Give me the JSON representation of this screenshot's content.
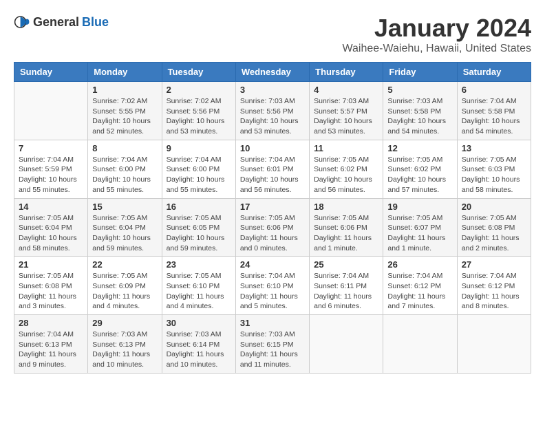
{
  "header": {
    "logo_general": "General",
    "logo_blue": "Blue",
    "month_title": "January 2024",
    "location": "Waihee-Waiehu, Hawaii, United States"
  },
  "calendar": {
    "days_of_week": [
      "Sunday",
      "Monday",
      "Tuesday",
      "Wednesday",
      "Thursday",
      "Friday",
      "Saturday"
    ],
    "weeks": [
      [
        {
          "day": "",
          "info": ""
        },
        {
          "day": "1",
          "info": "Sunrise: 7:02 AM\nSunset: 5:55 PM\nDaylight: 10 hours\nand 52 minutes."
        },
        {
          "day": "2",
          "info": "Sunrise: 7:02 AM\nSunset: 5:56 PM\nDaylight: 10 hours\nand 53 minutes."
        },
        {
          "day": "3",
          "info": "Sunrise: 7:03 AM\nSunset: 5:56 PM\nDaylight: 10 hours\nand 53 minutes."
        },
        {
          "day": "4",
          "info": "Sunrise: 7:03 AM\nSunset: 5:57 PM\nDaylight: 10 hours\nand 53 minutes."
        },
        {
          "day": "5",
          "info": "Sunrise: 7:03 AM\nSunset: 5:58 PM\nDaylight: 10 hours\nand 54 minutes."
        },
        {
          "day": "6",
          "info": "Sunrise: 7:04 AM\nSunset: 5:58 PM\nDaylight: 10 hours\nand 54 minutes."
        }
      ],
      [
        {
          "day": "7",
          "info": "Sunrise: 7:04 AM\nSunset: 5:59 PM\nDaylight: 10 hours\nand 55 minutes."
        },
        {
          "day": "8",
          "info": "Sunrise: 7:04 AM\nSunset: 6:00 PM\nDaylight: 10 hours\nand 55 minutes."
        },
        {
          "day": "9",
          "info": "Sunrise: 7:04 AM\nSunset: 6:00 PM\nDaylight: 10 hours\nand 55 minutes."
        },
        {
          "day": "10",
          "info": "Sunrise: 7:04 AM\nSunset: 6:01 PM\nDaylight: 10 hours\nand 56 minutes."
        },
        {
          "day": "11",
          "info": "Sunrise: 7:05 AM\nSunset: 6:02 PM\nDaylight: 10 hours\nand 56 minutes."
        },
        {
          "day": "12",
          "info": "Sunrise: 7:05 AM\nSunset: 6:02 PM\nDaylight: 10 hours\nand 57 minutes."
        },
        {
          "day": "13",
          "info": "Sunrise: 7:05 AM\nSunset: 6:03 PM\nDaylight: 10 hours\nand 58 minutes."
        }
      ],
      [
        {
          "day": "14",
          "info": "Sunrise: 7:05 AM\nSunset: 6:04 PM\nDaylight: 10 hours\nand 58 minutes."
        },
        {
          "day": "15",
          "info": "Sunrise: 7:05 AM\nSunset: 6:04 PM\nDaylight: 10 hours\nand 59 minutes."
        },
        {
          "day": "16",
          "info": "Sunrise: 7:05 AM\nSunset: 6:05 PM\nDaylight: 10 hours\nand 59 minutes."
        },
        {
          "day": "17",
          "info": "Sunrise: 7:05 AM\nSunset: 6:06 PM\nDaylight: 11 hours\nand 0 minutes."
        },
        {
          "day": "18",
          "info": "Sunrise: 7:05 AM\nSunset: 6:06 PM\nDaylight: 11 hours\nand 1 minute."
        },
        {
          "day": "19",
          "info": "Sunrise: 7:05 AM\nSunset: 6:07 PM\nDaylight: 11 hours\nand 1 minute."
        },
        {
          "day": "20",
          "info": "Sunrise: 7:05 AM\nSunset: 6:08 PM\nDaylight: 11 hours\nand 2 minutes."
        }
      ],
      [
        {
          "day": "21",
          "info": "Sunrise: 7:05 AM\nSunset: 6:08 PM\nDaylight: 11 hours\nand 3 minutes."
        },
        {
          "day": "22",
          "info": "Sunrise: 7:05 AM\nSunset: 6:09 PM\nDaylight: 11 hours\nand 4 minutes."
        },
        {
          "day": "23",
          "info": "Sunrise: 7:05 AM\nSunset: 6:10 PM\nDaylight: 11 hours\nand 4 minutes."
        },
        {
          "day": "24",
          "info": "Sunrise: 7:04 AM\nSunset: 6:10 PM\nDaylight: 11 hours\nand 5 minutes."
        },
        {
          "day": "25",
          "info": "Sunrise: 7:04 AM\nSunset: 6:11 PM\nDaylight: 11 hours\nand 6 minutes."
        },
        {
          "day": "26",
          "info": "Sunrise: 7:04 AM\nSunset: 6:12 PM\nDaylight: 11 hours\nand 7 minutes."
        },
        {
          "day": "27",
          "info": "Sunrise: 7:04 AM\nSunset: 6:12 PM\nDaylight: 11 hours\nand 8 minutes."
        }
      ],
      [
        {
          "day": "28",
          "info": "Sunrise: 7:04 AM\nSunset: 6:13 PM\nDaylight: 11 hours\nand 9 minutes."
        },
        {
          "day": "29",
          "info": "Sunrise: 7:03 AM\nSunset: 6:13 PM\nDaylight: 11 hours\nand 10 minutes."
        },
        {
          "day": "30",
          "info": "Sunrise: 7:03 AM\nSunset: 6:14 PM\nDaylight: 11 hours\nand 10 minutes."
        },
        {
          "day": "31",
          "info": "Sunrise: 7:03 AM\nSunset: 6:15 PM\nDaylight: 11 hours\nand 11 minutes."
        },
        {
          "day": "",
          "info": ""
        },
        {
          "day": "",
          "info": ""
        },
        {
          "day": "",
          "info": ""
        }
      ]
    ]
  }
}
